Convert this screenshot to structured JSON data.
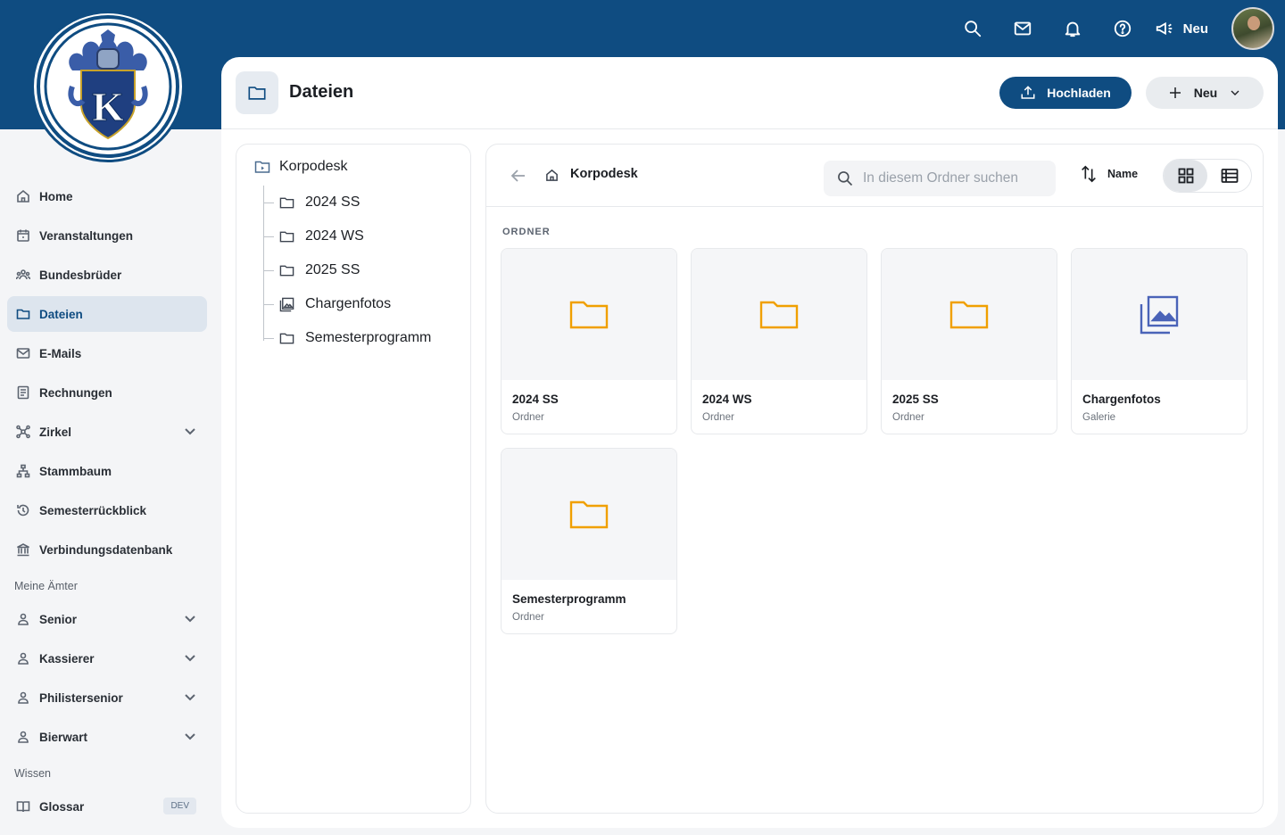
{
  "topbar": {
    "icons": [
      "search-icon",
      "mail-icon",
      "bell-icon",
      "help-icon",
      "megaphone-icon"
    ],
    "neu_label": "Neu",
    "brand_color": "#0f4c81"
  },
  "logo": {
    "letter": "K"
  },
  "sidebar": {
    "items": [
      {
        "label": "Home",
        "icon": "home-icon"
      },
      {
        "label": "Veranstaltungen",
        "icon": "calendar-icon"
      },
      {
        "label": "Bundesbrüder",
        "icon": "people-icon"
      },
      {
        "label": "Dateien",
        "icon": "folder-icon",
        "active": true
      },
      {
        "label": "E-Mails",
        "icon": "mail-icon"
      },
      {
        "label": "Rechnungen",
        "icon": "invoice-icon"
      },
      {
        "label": "Zirkel",
        "icon": "network-icon",
        "expandable": true
      },
      {
        "label": "Stammbaum",
        "icon": "tree-icon"
      },
      {
        "label": "Semesterrückblick",
        "icon": "history-icon"
      },
      {
        "label": "Verbindungsdatenbank",
        "icon": "bank-icon"
      }
    ],
    "section_amter": "Meine Ämter",
    "amter": [
      {
        "label": "Senior",
        "icon": "user-icon"
      },
      {
        "label": "Kassierer",
        "icon": "user-icon"
      },
      {
        "label": "Philistersenior",
        "icon": "user-icon"
      },
      {
        "label": "Bierwart",
        "icon": "user-icon"
      }
    ],
    "section_wissen": "Wissen",
    "wissen": [
      {
        "label": "Glossar",
        "icon": "book-icon",
        "badge": "DEV"
      }
    ]
  },
  "header": {
    "title": "Dateien",
    "upload_label": "Hochladen",
    "new_label": "Neu"
  },
  "tree": {
    "root": "Korpodesk",
    "items": [
      "2024 SS",
      "2024 WS",
      "2025 SS",
      "Chargenfotos",
      "Semesterprogramm"
    ]
  },
  "browser": {
    "breadcrumb": "Korpodesk",
    "search_placeholder": "In diesem Ordner suchen",
    "sort_label": "Name",
    "section_label": "ORDNER",
    "folder_color": "#f0a000",
    "gallery_color": "#4a63b8",
    "cards": [
      {
        "name": "2024 SS",
        "type": "Ordner",
        "icon": "folder-icon"
      },
      {
        "name": "2024 WS",
        "type": "Ordner",
        "icon": "folder-icon"
      },
      {
        "name": "2025 SS",
        "type": "Ordner",
        "icon": "folder-icon"
      },
      {
        "name": "Chargenfotos",
        "type": "Galerie",
        "icon": "gallery-icon"
      },
      {
        "name": "Semesterprogramm",
        "type": "Ordner",
        "icon": "folder-icon"
      }
    ]
  }
}
